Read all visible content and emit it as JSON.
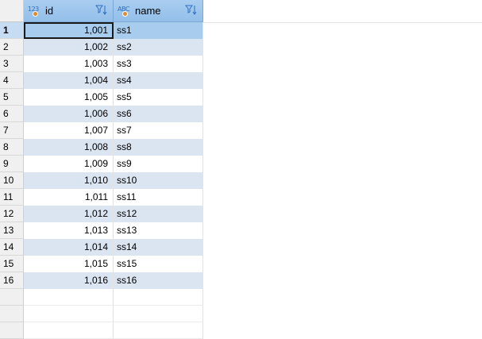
{
  "columns": [
    {
      "key": "id",
      "type_badge": "123",
      "label": "id",
      "type_icon": "numeric-type-icon"
    },
    {
      "key": "name",
      "type_badge": "ABC",
      "label": "name",
      "type_icon": "text-type-icon"
    }
  ],
  "selected_row": 1,
  "rows": [
    {
      "num": "1",
      "id": "1,001",
      "name": "ss1"
    },
    {
      "num": "2",
      "id": "1,002",
      "name": "ss2"
    },
    {
      "num": "3",
      "id": "1,003",
      "name": "ss3"
    },
    {
      "num": "4",
      "id": "1,004",
      "name": "ss4"
    },
    {
      "num": "5",
      "id": "1,005",
      "name": "ss5"
    },
    {
      "num": "6",
      "id": "1,006",
      "name": "ss6"
    },
    {
      "num": "7",
      "id": "1,007",
      "name": "ss7"
    },
    {
      "num": "8",
      "id": "1,008",
      "name": "ss8"
    },
    {
      "num": "9",
      "id": "1,009",
      "name": "ss9"
    },
    {
      "num": "10",
      "id": "1,010",
      "name": "ss10"
    },
    {
      "num": "11",
      "id": "1,011",
      "name": "ss11"
    },
    {
      "num": "12",
      "id": "1,012",
      "name": "ss12"
    },
    {
      "num": "13",
      "id": "1,013",
      "name": "ss13"
    },
    {
      "num": "14",
      "id": "1,014",
      "name": "ss14"
    },
    {
      "num": "15",
      "id": "1,015",
      "name": "ss15"
    },
    {
      "num": "16",
      "id": "1,016",
      "name": "ss16"
    }
  ],
  "colors": {
    "header_bg": "#9ec6ee",
    "row_alt_bg": "#dbe5f2",
    "selected_bg": "#a8ccee",
    "type_icon_dot": "#e08a2a"
  }
}
